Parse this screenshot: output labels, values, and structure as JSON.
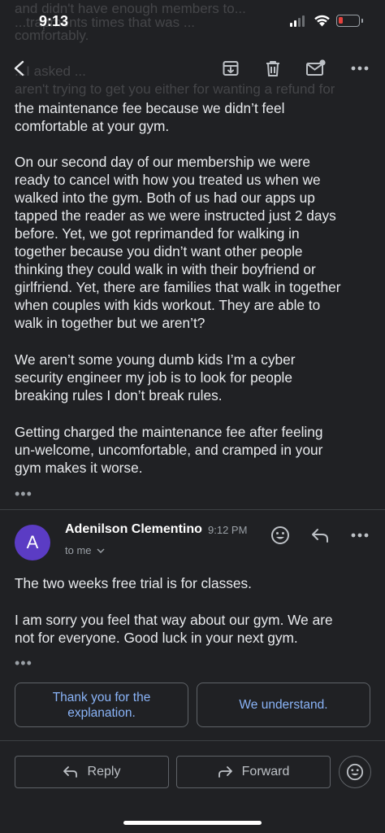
{
  "status_bar": {
    "time": "9:13"
  },
  "ghost_lines": [
    "and didn't have enough members to...",
    "...trapments times that was ...",
    "comfortably.",
    "...I asked ...",
    "aren't trying to get you either for wanting a refund for"
  ],
  "toolbar": {
    "back_icon": "back-arrow-icon",
    "archive_icon": "archive-icon",
    "delete_icon": "trash-icon",
    "mark_unread_icon": "mark-unread-icon",
    "more_icon": "more-horizontal-icon"
  },
  "message1": {
    "paragraphs": [
      [
        "the maintenance fee because we didn’t feel",
        "comfortable at your gym."
      ],
      [
        "On our second day of our membership we were",
        "ready to cancel with how you treated us when we",
        "walked into the gym. Both of us had our apps up",
        "tapped the reader as we were instructed just 2 days",
        "before. Yet, we got reprimanded for walking in",
        "together because you didn’t want other people",
        "thinking they could walk in with their boyfriend or",
        "girlfriend. Yet, there are families that walk in together",
        "when couples with kids workout. They are able to",
        "walk in together but we aren’t?"
      ],
      [
        "We aren’t some young dumb kids I’m a cyber",
        "security engineer my job is to look for people",
        "breaking rules I don’t break rules."
      ],
      [
        "Getting charged the maintenance fee after feeling",
        "un-welcome, uncomfortable, and cramped in your",
        "gym makes it worse."
      ]
    ],
    "ellipsis": "•••"
  },
  "message2": {
    "avatar_letter": "A",
    "sender": "Adenilson Clementino",
    "time": "9:12 PM",
    "to": "to me",
    "paragraphs": [
      [
        "The two weeks free trial is for classes."
      ],
      [
        "I am sorry you feel that way about our gym. We are",
        "not for everyone. Good luck in your next gym."
      ]
    ],
    "ellipsis": "•••"
  },
  "smart_replies": [
    "Thank you for the explanation.",
    "We understand."
  ],
  "bottom_actions": {
    "reply_label": "Reply",
    "forward_label": "Forward"
  },
  "colors": {
    "background": "#202124",
    "accent_link": "#8ab4f8",
    "avatar": "#5b3cc4",
    "battery_low": "#e5413c"
  }
}
